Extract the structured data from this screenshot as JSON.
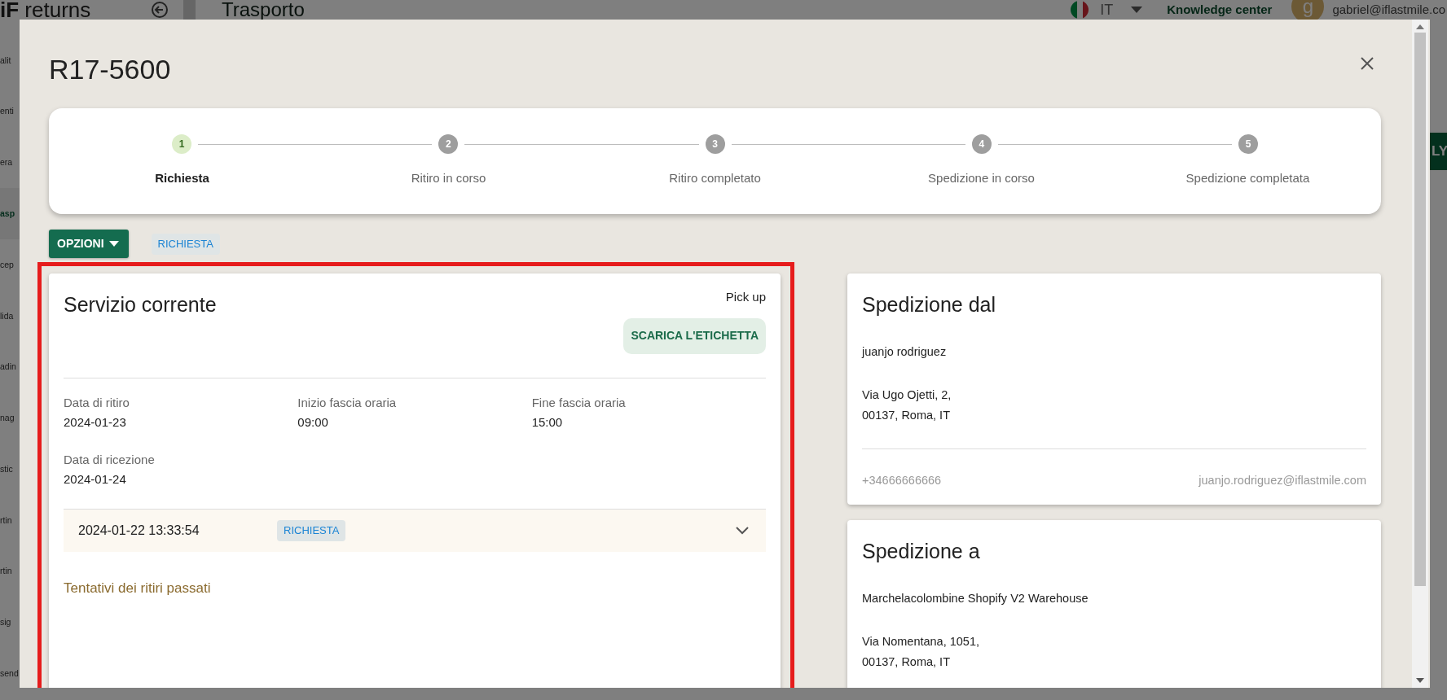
{
  "app": {
    "logo": "**iF** returns",
    "page_title": "Trasporto",
    "language": "IT",
    "help_link": "Knowledge center",
    "avatar_letter": "g",
    "user_email": "gabriel@iflastmile.co",
    "sidebar": [
      {
        "label": "alit",
        "selected": false
      },
      {
        "label": "enti",
        "selected": false
      },
      {
        "label": "era",
        "selected": false
      },
      {
        "label": "asp",
        "selected": true
      },
      {
        "label": "cep",
        "selected": false
      },
      {
        "label": "lida",
        "selected": false
      },
      {
        "label": "adin",
        "selected": false
      },
      {
        "label": "nag",
        "selected": false
      },
      {
        "label": "stic",
        "selected": false
      },
      {
        "label": "rtin",
        "selected": false
      },
      {
        "label": "rtin",
        "selected": false
      },
      {
        "label": "sig",
        "selected": false
      },
      {
        "label": "send",
        "selected": false
      }
    ],
    "side_button": "LY"
  },
  "modal": {
    "title": "R17-5600",
    "steps": [
      {
        "number": "1",
        "label": "Richiesta",
        "selected": true
      },
      {
        "number": "2",
        "label": "Ritiro in corso",
        "selected": false
      },
      {
        "number": "3",
        "label": "Ritiro completato",
        "selected": false
      },
      {
        "number": "4",
        "label": "Spedizione in corso",
        "selected": false
      },
      {
        "number": "5",
        "label": "Spedizione completata",
        "selected": false
      }
    ],
    "options_button": "OPZIONI",
    "status_chip": "RICHIESTA",
    "current_service": {
      "title": "Servizio corrente",
      "service_type": "Pick up",
      "download_button": "SCARICA L'ETICHETTA",
      "fields": [
        {
          "label": "Data di ritiro",
          "value": "2024-01-23"
        },
        {
          "label": "Inizio fascia oraria",
          "value": "09:00"
        },
        {
          "label": "Fine fascia oraria",
          "value": "15:00"
        },
        {
          "label": "Data di ricezione",
          "value": "2024-01-24"
        }
      ],
      "history": [
        {
          "timestamp": "2024-01-22 13:33:54",
          "status": "RICHIESTA",
          "expanded": false
        }
      ],
      "past_attempts_title": "Tentativi dei ritiri passati"
    },
    "sender": {
      "title": "Spedizione dal",
      "name": "juanjo rodriguez",
      "address_lines": [
        "Via Ugo Ojetti, 2,",
        "00137, Roma, IT"
      ],
      "phone": "+34666666666",
      "email": "juanjo.rodriguez@iflastmile.com"
    },
    "recipient": {
      "title": "Spedizione a",
      "name": "Marchelacolombine Shopify V2 Warehouse",
      "address_lines": [
        "Via Nomentana, 1051,",
        "00137, Roma, IT"
      ]
    }
  }
}
